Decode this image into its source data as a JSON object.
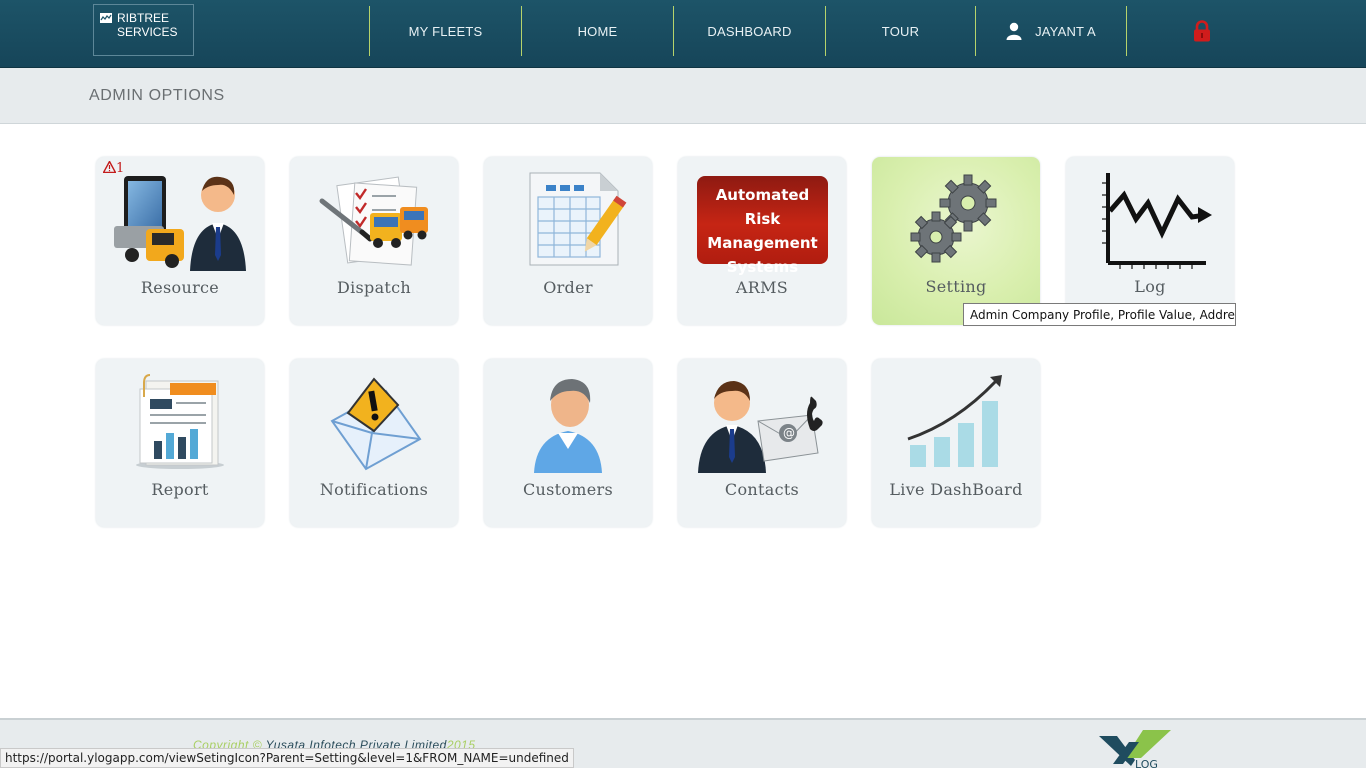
{
  "brand": {
    "line1": "RIBTREE",
    "line2": "SERVICES"
  },
  "nav": {
    "my_fleets": "MY FLEETS",
    "home": "HOME",
    "dashboard": "DASHBOARD",
    "tour": "TOUR",
    "user": "JAYANT A"
  },
  "subheader": {
    "title": "ADMIN OPTIONS"
  },
  "tiles": {
    "resource": {
      "label": "Resource",
      "alert_count": "1"
    },
    "dispatch": {
      "label": "Dispatch"
    },
    "order": {
      "label": "Order"
    },
    "arms": {
      "label": "ARMS",
      "badge_line1": "Automated Risk",
      "badge_line2": "Management",
      "badge_line3": "Systems"
    },
    "setting": {
      "label": "Setting"
    },
    "log": {
      "label": "Log"
    },
    "report": {
      "label": "Report"
    },
    "notifications": {
      "label": "Notifications"
    },
    "customers": {
      "label": "Customers"
    },
    "contacts": {
      "label": "Contacts"
    },
    "live_dashboard": {
      "label": "Live DashBoard"
    }
  },
  "tooltip": {
    "text": "Admin Company Profile, Profile Value, Address...."
  },
  "footer": {
    "copyright_prefix": "Copyright © ",
    "company": "Yusata Infotech Private Limited",
    "year": "2015"
  },
  "status_url": "https://portal.ylogapp.com/viewSetingIcon?Parent=Setting&level=1&FROM_NAME=undefined",
  "colors": {
    "header": "#1d5468",
    "nav_divider": "#b6d36b",
    "active_tile": "#d9efae",
    "accent_green": "#a9cf63"
  }
}
